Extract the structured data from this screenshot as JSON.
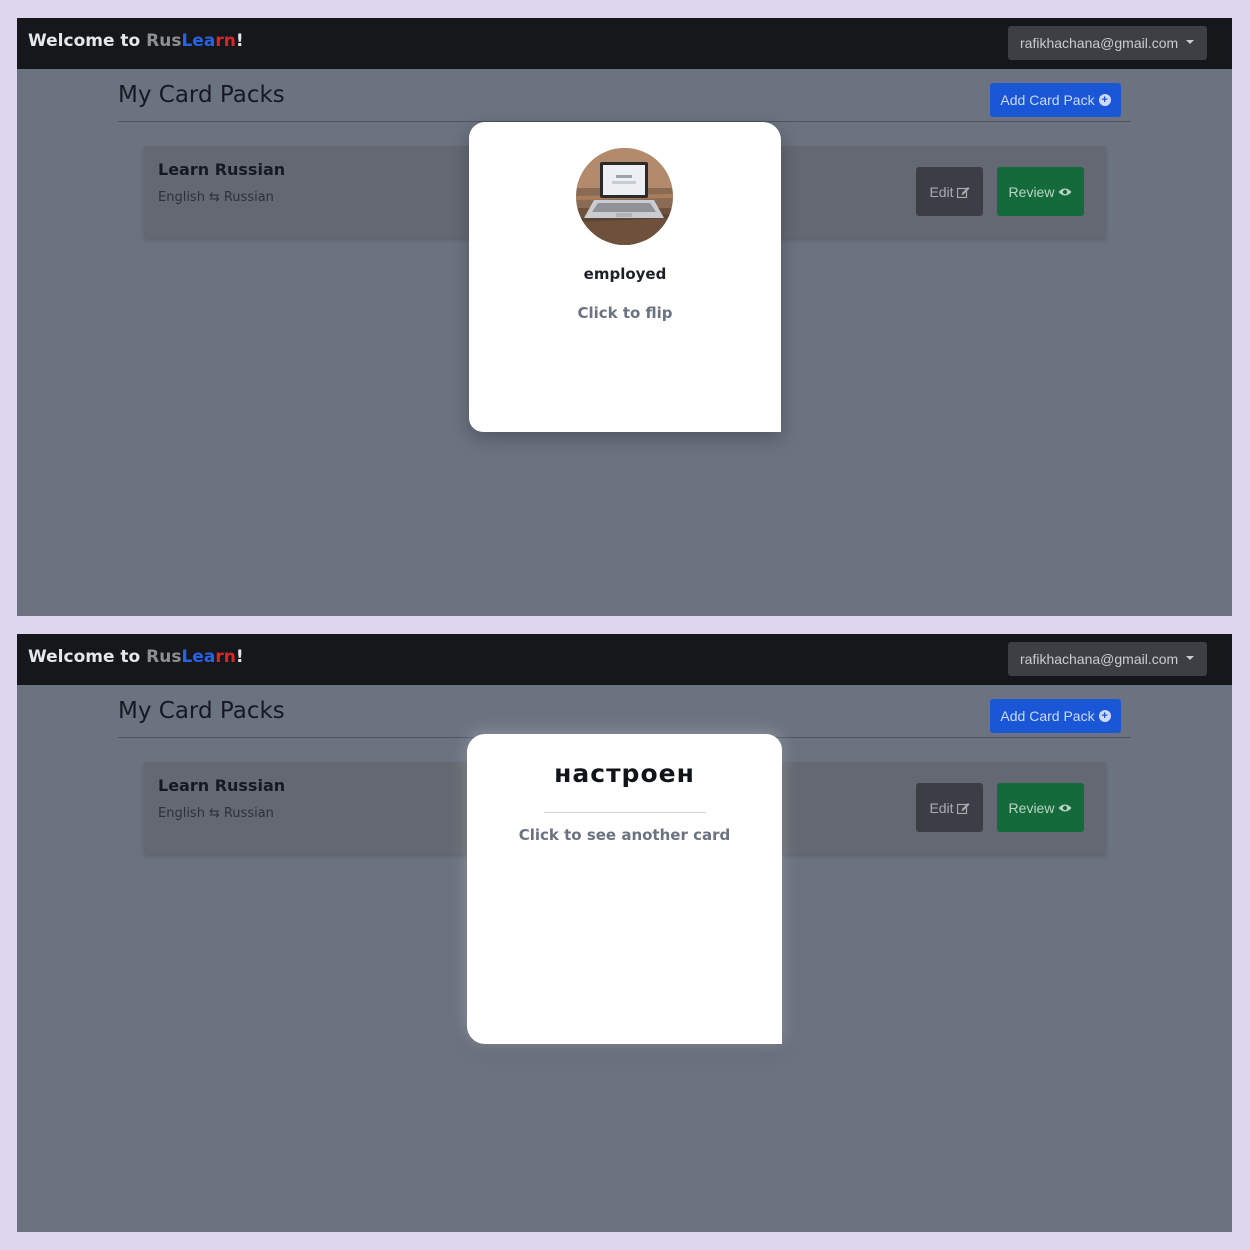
{
  "screens": [
    {
      "navbar": {
        "brand_prefix": "Welcome to ",
        "brand_rus": "Rus",
        "brand_lea": "Lea",
        "brand_rn": "rn",
        "brand_suffix": "!",
        "user_email": "rafikhachana@gmail.com"
      },
      "page_title": "My Card Packs",
      "add_button_label": "Add Card Pack",
      "pack": {
        "name": "Learn Russian",
        "from_language": "English",
        "to_language": "Russian",
        "edit_label": "Edit",
        "review_label": "Review"
      },
      "flashcard": {
        "side": "front",
        "word": "employed",
        "hint": "Click to flip",
        "image_icon": "laptop-photo"
      }
    },
    {
      "navbar": {
        "brand_prefix": "Welcome to ",
        "brand_rus": "Rus",
        "brand_lea": "Lea",
        "brand_rn": "rn",
        "brand_suffix": "!",
        "user_email": "rafikhachana@gmail.com"
      },
      "page_title": "My Card Packs",
      "add_button_label": "Add Card Pack",
      "pack": {
        "name": "Learn Russian",
        "from_language": "English",
        "to_language": "Russian",
        "edit_label": "Edit",
        "review_label": "Review"
      },
      "flashcard": {
        "side": "back",
        "translation": "настроен",
        "hint": "Click to see another card"
      }
    }
  ],
  "colors": {
    "page_bg": "#ddd6ec",
    "overlay_bg": "#6b7280",
    "navbar_bg": "#15171a",
    "primary": "#1a57d6",
    "success": "#156a3c",
    "secondary": "#3b3f45",
    "brand_blue": "#2563eb",
    "brand_red": "#dc2626"
  }
}
